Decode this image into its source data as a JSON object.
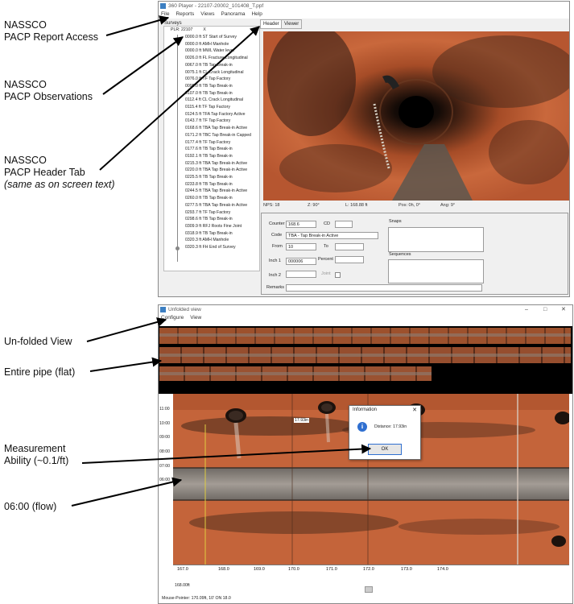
{
  "annotations": {
    "report_access": [
      "NASSCO",
      "PACP Report Access"
    ],
    "observations": [
      "NASSCO",
      "PACP Observations"
    ],
    "header_tab": [
      "NASSCO",
      "PACP Header Tab"
    ],
    "header_tab_note": "(same as on screen text)",
    "unfolded": "Un-folded View",
    "entire_pipe": "Entire pipe (flat)",
    "measurement": [
      "Measurement",
      "Ability (~0.1/ft)"
    ],
    "flow": "06:00 (flow)"
  },
  "player": {
    "title": "360 Player - 22107-20002_101408_T.ppf",
    "menu": [
      "File",
      "Reports",
      "Views",
      "Panorama",
      "Help"
    ],
    "tree_root": "Surveys",
    "tree_node": "PLR: 22107",
    "tree_node_x": "X",
    "observations": [
      "0000.0 ft ST Start of Survey",
      "0000.0 ft AMH Manhole",
      "0000.0 ft MWL Water level",
      "0026.0 ft FL Fracture Longitudinal",
      "0067.0 ft TB Tap Break-in",
      "0075.1 ft CL Crack Longitudinal",
      "0076.0 ft TF Tap Factory",
      "0095.0 ft TB Tap Break-in",
      "0107.0 ft TB Tap Break-in",
      "0112.4 ft CL Crack Longitudinal",
      "0115.4 ft TF Tap Factory",
      "0124.5 ft TFA Tap Factory Active",
      "0143.7 ft TF Tap Factory",
      "0168.6 ft TBA Tap Break-in Active",
      "0171.2 ft TBC Tap Break-in Capped",
      "0177.4 ft TF Tap Factory",
      "0177.6 ft TB Tap Break-in",
      "0192.1 ft TB Tap Break-in",
      "0215.3 ft TBA Tap Break-in Active",
      "0220.0 ft TBA Tap Break-in Active",
      "0225.5 ft TB Tap Break-in",
      "0233.8 ft TB Tap Break-in",
      "0244.5 ft TBA Tap Break-in Active",
      "0260.0 ft TB Tap Break-in",
      "0277.5 ft TBA Tap Break-in Active",
      "0293.7 ft TF Tap Factory",
      "0298.6 ft TB Tap Break-in",
      "0309.9 ft RFJ Roots Fine Joint",
      "0318.9 ft TB Tap Break-in",
      "0320.3 ft AMH Manhole",
      "0320.3 ft FH End of Survey"
    ],
    "tabs": [
      "Header",
      "Viewer"
    ],
    "status": {
      "nps": "NPS: 18",
      "z": "Z: 90°",
      "l": "L: 168.88 ft",
      "pos": "Pos: 0h, 0°",
      "ang": "Ang: 9°"
    },
    "form": {
      "counter_label": "Counter",
      "counter": "168.6",
      "cd_label": "CD",
      "cd": "",
      "code_label": "Code",
      "code": "TBA - Tap Break-in Active",
      "from_label": "From",
      "from": "10",
      "to_label": "To",
      "to": "",
      "inch1_label": "Inch 1",
      "inch1": "000006",
      "percent_label": "Percent",
      "percent": "",
      "inch2_label": "Inch 2",
      "inch2": "",
      "joint_label": "Joint",
      "remarks_label": "Remarks",
      "remarks": "",
      "snaps_label": "Snaps",
      "sequences_label": "Sequences"
    }
  },
  "unfolded": {
    "title": "Unfolded view",
    "menu": [
      "Configure",
      "View"
    ],
    "clock": [
      "11:00",
      "10:00",
      "09:00",
      "08:00",
      "07:00",
      "06:00"
    ],
    "ruler": [
      "167.0",
      "168.0",
      "169.0",
      "170.0",
      "171.0",
      "172.0",
      "173.0",
      "174.0"
    ],
    "pos_label": "168.00ft",
    "measure_label": "17.93in",
    "mouse_pointer": "Mouse-Pointer: 170.09ft, 10' ON 18.0",
    "dialog": {
      "title": "Information",
      "message": "Distance: 17.93in",
      "ok": "OK"
    }
  },
  "colors": {
    "pipe_orange": "#c4643a",
    "dark": "#1a1a1a",
    "flow_gray": "#8d8680"
  }
}
